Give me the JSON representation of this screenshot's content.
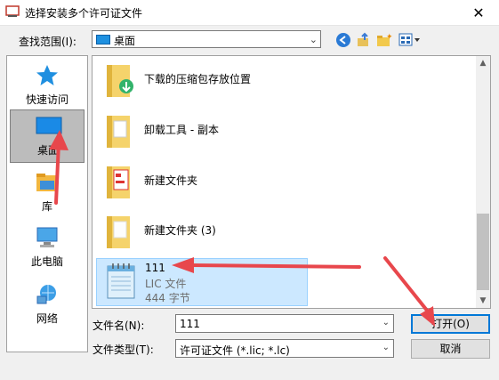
{
  "window": {
    "title": "选择安装多个许可证文件",
    "close_glyph": "✕"
  },
  "toolbar": {
    "look_in_label": "查找范围(I):",
    "look_in_value": "桌面"
  },
  "places": [
    {
      "label": "快速访问",
      "icon": "star-icon"
    },
    {
      "label": "桌面",
      "icon": "desktop-icon"
    },
    {
      "label": "库",
      "icon": "library-icon"
    },
    {
      "label": "此电脑",
      "icon": "computer-icon"
    },
    {
      "label": "网络",
      "icon": "network-icon"
    }
  ],
  "files": [
    {
      "name": "下载的压缩包存放位置",
      "icon": "folder-icon"
    },
    {
      "name": "卸载工具 - 副本",
      "icon": "folder-icon"
    },
    {
      "name": "新建文件夹",
      "icon": "folder-icon"
    },
    {
      "name": "新建文件夹 (3)",
      "icon": "folder-icon"
    },
    {
      "name": "111",
      "type": "LIC 文件",
      "size": "444 字节",
      "icon": "notepad-icon"
    }
  ],
  "form": {
    "filename_label": "文件名(N):",
    "filename_value": "111",
    "filetype_label": "文件类型(T):",
    "filetype_value": "许可证文件 (*.lic; *.lc)"
  },
  "buttons": {
    "open": "打开(O)",
    "cancel": "取消"
  },
  "colors": {
    "arrow": "#e8474c",
    "selection": "#cce8ff",
    "accent": "#0078d7"
  }
}
